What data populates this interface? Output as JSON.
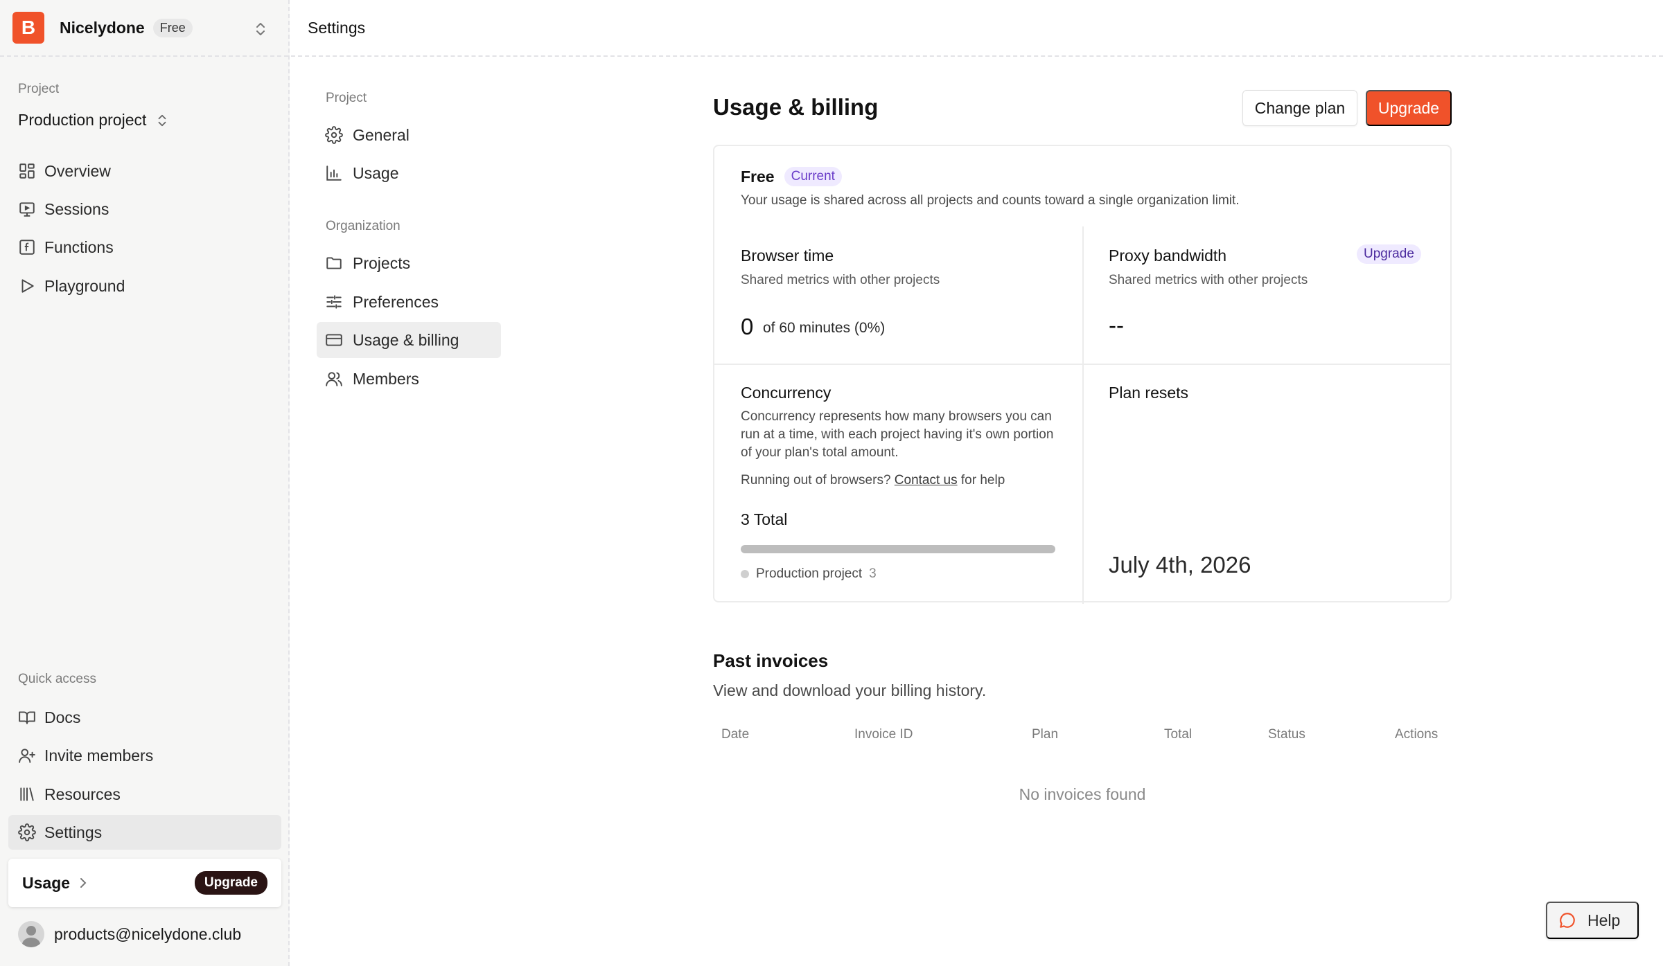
{
  "colors": {
    "brand": "#f0522a",
    "badge_purple_bg": "#efeaff",
    "badge_purple_text": "#6a3dc9"
  },
  "org": {
    "logo_letter": "B",
    "name": "Nicelydone",
    "plan": "Free"
  },
  "sidebar": {
    "project_label": "Project",
    "project_name": "Production project",
    "nav": [
      {
        "label": "Overview",
        "icon": "grid-icon"
      },
      {
        "label": "Sessions",
        "icon": "monitor-icon"
      },
      {
        "label": "Functions",
        "icon": "function-icon"
      },
      {
        "label": "Playground",
        "icon": "play-icon"
      }
    ],
    "quick_access_label": "Quick access",
    "quick": [
      {
        "label": "Docs",
        "icon": "book-icon"
      },
      {
        "label": "Invite members",
        "icon": "user-plus-icon"
      },
      {
        "label": "Resources",
        "icon": "library-icon"
      },
      {
        "label": "Settings",
        "icon": "gear-icon",
        "active": true
      }
    ],
    "usage_card": {
      "label": "Usage",
      "upgrade": "Upgrade"
    },
    "user_email": "products@nicelydone.club"
  },
  "topbar": {
    "title": "Settings"
  },
  "settings_nav": {
    "project_label": "Project",
    "project_items": [
      {
        "label": "General",
        "icon": "gear-icon"
      },
      {
        "label": "Usage",
        "icon": "bar-chart-icon"
      }
    ],
    "org_label": "Organization",
    "org_items": [
      {
        "label": "Projects",
        "icon": "folder-icon"
      },
      {
        "label": "Preferences",
        "icon": "sliders-icon"
      },
      {
        "label": "Usage & billing",
        "icon": "credit-card-icon",
        "active": true
      },
      {
        "label": "Members",
        "icon": "users-icon"
      }
    ]
  },
  "main": {
    "title": "Usage & billing",
    "change_plan": "Change plan",
    "upgrade": "Upgrade",
    "plan": {
      "name": "Free",
      "badge": "Current",
      "description": "Your usage is shared across all projects and counts toward a single organization limit.",
      "browser_time": {
        "title": "Browser time",
        "subtitle": "Shared metrics with other projects",
        "value": "0",
        "of_text": "of 60 minutes (0%)"
      },
      "proxy_bandwidth": {
        "title": "Proxy bandwidth",
        "subtitle": "Shared metrics with other projects",
        "badge": "Upgrade",
        "value": "--"
      },
      "concurrency": {
        "title": "Concurrency",
        "description": "Concurrency represents how many browsers you can run at a time, with each project having it's own portion of your plan's total amount.",
        "help_prefix": "Running out of browsers?",
        "help_link": "Contact us",
        "help_suffix": "for help",
        "total": "3 Total",
        "progress": 1.0,
        "legend": {
          "name": "Production project",
          "count": "3"
        }
      },
      "plan_resets": {
        "title": "Plan resets",
        "date": "July 4th, 2026"
      }
    },
    "invoices": {
      "title": "Past invoices",
      "subtitle": "View and download your billing history.",
      "columns": [
        "Date",
        "Invoice ID",
        "Plan",
        "Total",
        "Status",
        "Actions"
      ],
      "empty": "No invoices found"
    }
  },
  "help": {
    "label": "Help"
  }
}
